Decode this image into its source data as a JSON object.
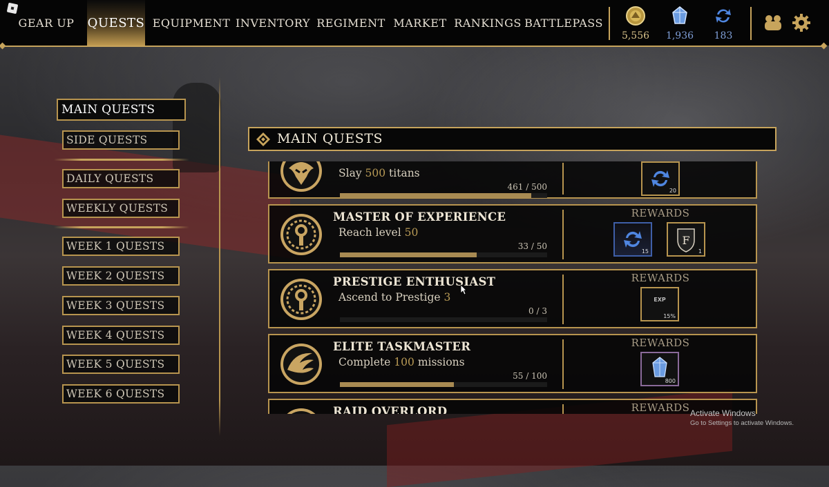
{
  "nav": {
    "tabs": [
      {
        "label": "GEAR UP"
      },
      {
        "label": "QUESTS"
      },
      {
        "label": "EQUIPMENT"
      },
      {
        "label": "INVENTORY"
      },
      {
        "label": "REGIMENT"
      },
      {
        "label": "MARKET"
      },
      {
        "label": "RANKINGS"
      },
      {
        "label": "BATTLEPASS"
      }
    ],
    "active_tab": "QUESTS"
  },
  "currencies": [
    {
      "icon": "gold-coin-icon",
      "value": "5,556",
      "color": "#d8c28a"
    },
    {
      "icon": "crystal-icon",
      "value": "1,936",
      "color": "#7f9fd8"
    },
    {
      "icon": "spin-icon",
      "value": "183",
      "color": "#7f9fd8"
    }
  ],
  "sidebar": {
    "items": [
      {
        "label": "MAIN QUESTS"
      },
      {
        "label": "SIDE QUESTS"
      },
      {
        "label": "DAILY QUESTS"
      },
      {
        "label": "WEEKLY QUESTS"
      },
      {
        "label": "WEEK 1 QUESTS"
      },
      {
        "label": "WEEK 2 QUESTS"
      },
      {
        "label": "WEEK 3 QUESTS"
      },
      {
        "label": "WEEK 4 QUESTS"
      },
      {
        "label": "WEEK 5 QUESTS"
      },
      {
        "label": "WEEK 6 QUESTS"
      }
    ]
  },
  "main": {
    "header": "MAIN QUESTS",
    "quests": [
      {
        "name": "",
        "desc_pre": "Slay",
        "target": "500",
        "desc_post": "titans",
        "progress": "461 / 500",
        "fraction": 0.922,
        "rewards_label": "",
        "rewards": [
          {
            "icon": "spin-icon",
            "value": "20"
          }
        ]
      },
      {
        "name": "MASTER OF EXPERIENCE",
        "desc_pre": "Reach level",
        "target": "50",
        "desc_post": "",
        "progress": "33 / 50",
        "fraction": 0.66,
        "rewards_label": "REWARDS",
        "rewards": [
          {
            "icon": "spin-icon",
            "value": "15"
          },
          {
            "icon": "shield-f-icon",
            "value": "1"
          }
        ]
      },
      {
        "name": "PRESTIGE ENTHUSIAST",
        "desc_pre": "Ascend to Prestige",
        "target": "3",
        "desc_post": "",
        "progress": "0 / 3",
        "fraction": 0,
        "rewards_label": "REWARDS",
        "rewards": [
          {
            "icon": "exp-boost-icon",
            "value": "15%",
            "text": "EXP"
          }
        ]
      },
      {
        "name": "ELITE TASKMASTER",
        "desc_pre": "Complete",
        "target": "100",
        "desc_post": "missions",
        "progress": "55 / 100",
        "fraction": 0.55,
        "rewards_label": "REWARDS",
        "rewards": [
          {
            "icon": "crystal-icon",
            "value": "800"
          }
        ]
      },
      {
        "name": "RAID OVERLORD",
        "desc_pre": "",
        "target": "",
        "desc_post": "",
        "progress": "",
        "fraction": 0,
        "rewards_label": "REWARDS",
        "rewards": []
      }
    ]
  },
  "watermark": {
    "line1": "Activate Windows",
    "line2": "Go to Settings to activate Windows."
  }
}
